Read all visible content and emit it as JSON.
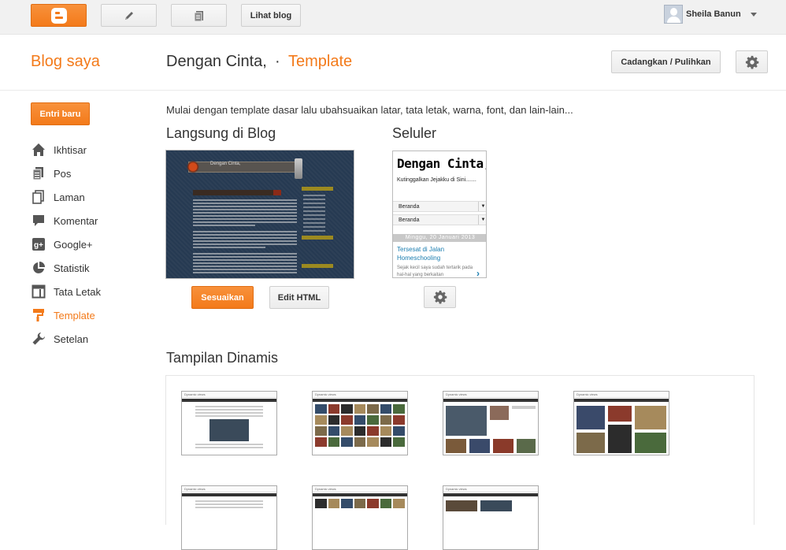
{
  "topbar": {
    "view_blog": "Lihat blog",
    "user_name": "Sheila Banun"
  },
  "header": {
    "my_blogs": "Blog saya",
    "blog_title": "Dengan Cinta,",
    "separator": "·",
    "section": "Template",
    "backup_button": "Cadangkan / Pulihkan"
  },
  "sidebar": {
    "new_post": "Entri baru",
    "items": [
      {
        "label": "Ikhtisar",
        "icon": "home-icon"
      },
      {
        "label": "Pos",
        "icon": "posts-icon"
      },
      {
        "label": "Laman",
        "icon": "pages-icon"
      },
      {
        "label": "Komentar",
        "icon": "comment-icon"
      },
      {
        "label": "Google+",
        "icon": "google-plus-icon"
      },
      {
        "label": "Statistik",
        "icon": "pie-chart-icon"
      },
      {
        "label": "Tata Letak",
        "icon": "layout-icon"
      },
      {
        "label": "Template",
        "icon": "paint-roller-icon",
        "active": true
      },
      {
        "label": "Setelan",
        "icon": "wrench-icon"
      }
    ]
  },
  "main": {
    "intro": "Mulai dengan template dasar lalu ubahsuaikan latar, tata letak, warna, font, dan lain-lain...",
    "live_heading": "Langsung di Blog",
    "mobile_heading": "Seluler",
    "customize_button": "Sesuaikan",
    "edit_html_button": "Edit HTML",
    "dynamic_heading": "Tampilan Dinamis",
    "live_preview": {
      "blog_title": "Dengan Cinta,"
    },
    "mobile_preview": {
      "title": "Dengan Cinta,",
      "description": "Kutinggalkan Jejakku di Sini.......",
      "menu1": "Beranda",
      "menu2": "Beranda",
      "date": "Minggu, 20 Januari 2013",
      "post_title": "Tersesat di Jalan Homeschooling",
      "snippet": "Sejak kecil saya sudah tertarik pada hal-hal yang berkaitan"
    }
  },
  "colors": {
    "accent": "#f37a1a",
    "link": "#1a7db0"
  }
}
